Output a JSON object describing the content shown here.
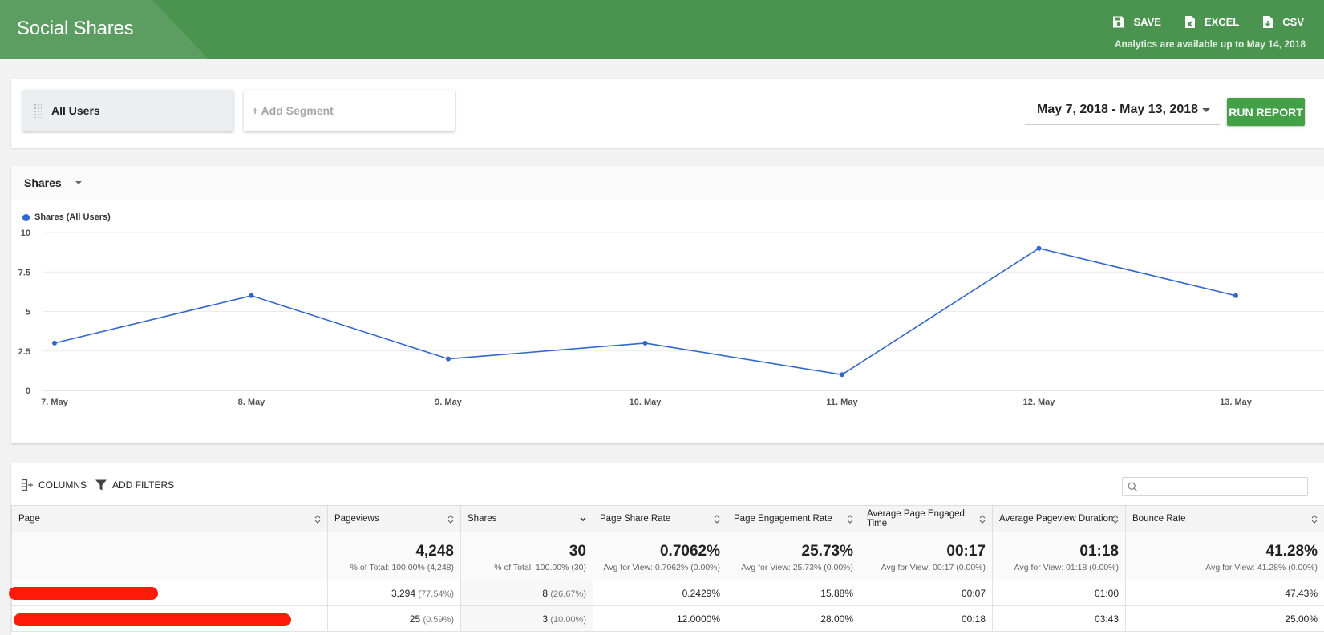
{
  "header": {
    "title": "Social Shares",
    "save_label": "SAVE",
    "excel_label": "EXCEL",
    "csv_label": "CSV",
    "availability": "Analytics are available up to May 14, 2018"
  },
  "segments": {
    "active": "All Users",
    "add_label": "+ Add Segment"
  },
  "date_range": "May 7, 2018 - May 13, 2018",
  "run_report_label": "RUN REPORT",
  "chart_panel": {
    "metric_selector": "Shares"
  },
  "chart_data": {
    "type": "line",
    "categories": [
      "7. May",
      "8. May",
      "9. May",
      "10. May",
      "11. May",
      "12. May",
      "13. May"
    ],
    "series": [
      {
        "name": "Shares (All Users)",
        "values": [
          3,
          6,
          2,
          3,
          1,
          9,
          6
        ],
        "color": "#3366cc"
      }
    ],
    "yticks": [
      "0",
      "2.5",
      "5",
      "7.5",
      "10"
    ],
    "ylim": [
      0,
      10
    ],
    "grid": true,
    "legend": "top-left"
  },
  "table": {
    "toolbar": {
      "columns_label": "COLUMNS",
      "filters_label": "ADD FILTERS",
      "search_value": ""
    },
    "columns": [
      "Page",
      "Pageviews",
      "Shares",
      "Page Share Rate",
      "Page Engagement Rate",
      "Average Page Engaged Time",
      "Average Pageview Duration",
      "Bounce Rate"
    ],
    "totals": {
      "pageviews": {
        "value": "4,248",
        "sub": "% of Total: 100.00% (4,248)"
      },
      "shares": {
        "value": "30",
        "sub": "% of Total: 100.00% (30)"
      },
      "share_rate": {
        "value": "0.7062%",
        "sub": "Avg for View: 0.7062% (0.00%)"
      },
      "engagement_rate": {
        "value": "25.73%",
        "sub": "Avg for View: 25.73% (0.00%)"
      },
      "engaged_time": {
        "value": "00:17",
        "sub": "Avg for View: 00:17 (0.00%)"
      },
      "pageview_duration": {
        "value": "01:18",
        "sub": "Avg for View: 01:18 (0.00%)"
      },
      "bounce_rate": {
        "value": "41.28%",
        "sub": "Avg for View: 41.28% (0.00%)"
      }
    },
    "rows": [
      {
        "pageviews": "3,294",
        "pageviews_pct": "(77.54%)",
        "shares": "8",
        "shares_pct": "(26.67%)",
        "share_rate": "0.2429%",
        "engagement_rate": "15.88%",
        "engaged_time": "00:07",
        "pageview_duration": "01:00",
        "bounce_rate": "47.43%"
      },
      {
        "pageviews": "25",
        "pageviews_pct": "(0.59%)",
        "shares": "3",
        "shares_pct": "(10.00%)",
        "share_rate": "12.0000%",
        "engagement_rate": "28.00%",
        "engaged_time": "00:18",
        "pageview_duration": "03:43",
        "bounce_rate": "25.00%"
      }
    ]
  }
}
